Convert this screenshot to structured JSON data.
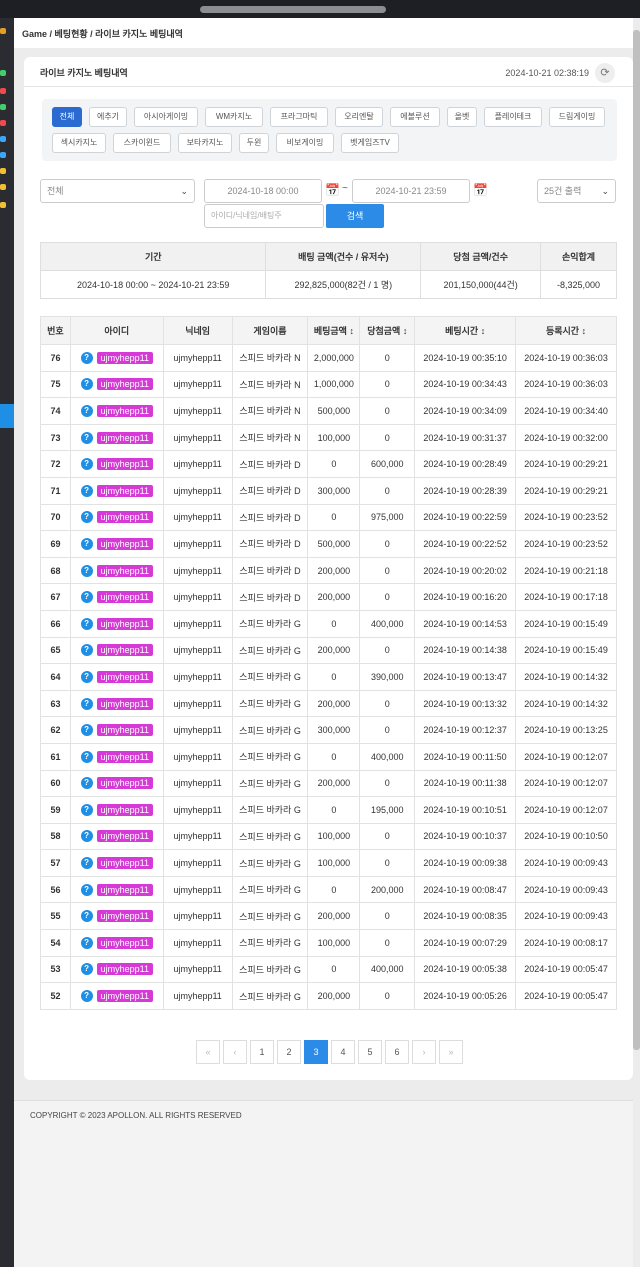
{
  "breadcrumb": "Game / 베팅현황 / 라이브 카지노 베팅내역",
  "card": {
    "title": "라이브 카지노 베팅내역",
    "time": "2024-10-21 02:38:19"
  },
  "categories": [
    "전체",
    "에추기",
    "아시아게이밍",
    "WM카지노",
    "프라그마틱",
    "오리엔탈",
    "에볼루션",
    "올벳",
    "플레이테크",
    "드림게이밍",
    "섹시카지노",
    "스카이윈드",
    "보타카지노",
    "두윈",
    "비보게이밍",
    "벳게임즈TV"
  ],
  "filters": {
    "select_value": "전체",
    "date_from": "2024-10-18 00:00",
    "date_to": "2024-10-21 23:59",
    "per_page": "25건 출력",
    "search_placeholder": "아이디/닉네임/배팅주",
    "search_label": "검색"
  },
  "summary": {
    "headers": [
      "기간",
      "배팅 금액(건수 / 유저수)",
      "당첨 금액/건수",
      "손익합계"
    ],
    "values": [
      "2024-10-18 00:00 ~ 2024-10-21 23:59",
      "292,825,000(82건 / 1 명)",
      "201,150,000(44건)",
      "-8,325,000"
    ]
  },
  "table": {
    "headers": [
      "번호",
      "아이디",
      "닉네임",
      "게임이름",
      "베팅금액 ↕",
      "당첨금액 ↕",
      "베팅시간 ↕",
      "등록시간 ↕"
    ],
    "rows": [
      [
        "76",
        "ujmyhepp11",
        "ujmyhepp11",
        "스피드 바카라 N",
        "2,000,000",
        "0",
        "2024-10-19 00:35:10",
        "2024-10-19 00:36:03"
      ],
      [
        "75",
        "ujmyhepp11",
        "ujmyhepp11",
        "스피드 바카라 N",
        "1,000,000",
        "0",
        "2024-10-19 00:34:43",
        "2024-10-19 00:36:03"
      ],
      [
        "74",
        "ujmyhepp11",
        "ujmyhepp11",
        "스피드 바카라 N",
        "500,000",
        "0",
        "2024-10-19 00:34:09",
        "2024-10-19 00:34:40"
      ],
      [
        "73",
        "ujmyhepp11",
        "ujmyhepp11",
        "스피드 바카라 N",
        "100,000",
        "0",
        "2024-10-19 00:31:37",
        "2024-10-19 00:32:00"
      ],
      [
        "72",
        "ujmyhepp11",
        "ujmyhepp11",
        "스피드 바카라 D",
        "0",
        "600,000",
        "2024-10-19 00:28:49",
        "2024-10-19 00:29:21"
      ],
      [
        "71",
        "ujmyhepp11",
        "ujmyhepp11",
        "스피드 바카라 D",
        "300,000",
        "0",
        "2024-10-19 00:28:39",
        "2024-10-19 00:29:21"
      ],
      [
        "70",
        "ujmyhepp11",
        "ujmyhepp11",
        "스피드 바카라 D",
        "0",
        "975,000",
        "2024-10-19 00:22:59",
        "2024-10-19 00:23:52"
      ],
      [
        "69",
        "ujmyhepp11",
        "ujmyhepp11",
        "스피드 바카라 D",
        "500,000",
        "0",
        "2024-10-19 00:22:52",
        "2024-10-19 00:23:52"
      ],
      [
        "68",
        "ujmyhepp11",
        "ujmyhepp11",
        "스피드 바카라 D",
        "200,000",
        "0",
        "2024-10-19 00:20:02",
        "2024-10-19 00:21:18"
      ],
      [
        "67",
        "ujmyhepp11",
        "ujmyhepp11",
        "스피드 바카라 D",
        "200,000",
        "0",
        "2024-10-19 00:16:20",
        "2024-10-19 00:17:18"
      ],
      [
        "66",
        "ujmyhepp11",
        "ujmyhepp11",
        "스피드 바카라 G",
        "0",
        "400,000",
        "2024-10-19 00:14:53",
        "2024-10-19 00:15:49"
      ],
      [
        "65",
        "ujmyhepp11",
        "ujmyhepp11",
        "스피드 바카라 G",
        "200,000",
        "0",
        "2024-10-19 00:14:38",
        "2024-10-19 00:15:49"
      ],
      [
        "64",
        "ujmyhepp11",
        "ujmyhepp11",
        "스피드 바카라 G",
        "0",
        "390,000",
        "2024-10-19 00:13:47",
        "2024-10-19 00:14:32"
      ],
      [
        "63",
        "ujmyhepp11",
        "ujmyhepp11",
        "스피드 바카라 G",
        "200,000",
        "0",
        "2024-10-19 00:13:32",
        "2024-10-19 00:14:32"
      ],
      [
        "62",
        "ujmyhepp11",
        "ujmyhepp11",
        "스피드 바카라 G",
        "300,000",
        "0",
        "2024-10-19 00:12:37",
        "2024-10-19 00:13:25"
      ],
      [
        "61",
        "ujmyhepp11",
        "ujmyhepp11",
        "스피드 바카라 G",
        "0",
        "400,000",
        "2024-10-19 00:11:50",
        "2024-10-19 00:12:07"
      ],
      [
        "60",
        "ujmyhepp11",
        "ujmyhepp11",
        "스피드 바카라 G",
        "200,000",
        "0",
        "2024-10-19 00:11:38",
        "2024-10-19 00:12:07"
      ],
      [
        "59",
        "ujmyhepp11",
        "ujmyhepp11",
        "스피드 바카라 G",
        "0",
        "195,000",
        "2024-10-19 00:10:51",
        "2024-10-19 00:12:07"
      ],
      [
        "58",
        "ujmyhepp11",
        "ujmyhepp11",
        "스피드 바카라 G",
        "100,000",
        "0",
        "2024-10-19 00:10:37",
        "2024-10-19 00:10:50"
      ],
      [
        "57",
        "ujmyhepp11",
        "ujmyhepp11",
        "스피드 바카라 G",
        "100,000",
        "0",
        "2024-10-19 00:09:38",
        "2024-10-19 00:09:43"
      ],
      [
        "56",
        "ujmyhepp11",
        "ujmyhepp11",
        "스피드 바카라 G",
        "0",
        "200,000",
        "2024-10-19 00:08:47",
        "2024-10-19 00:09:43"
      ],
      [
        "55",
        "ujmyhepp11",
        "ujmyhepp11",
        "스피드 바카라 G",
        "200,000",
        "0",
        "2024-10-19 00:08:35",
        "2024-10-19 00:09:43"
      ],
      [
        "54",
        "ujmyhepp11",
        "ujmyhepp11",
        "스피드 바카라 G",
        "100,000",
        "0",
        "2024-10-19 00:07:29",
        "2024-10-19 00:08:17"
      ],
      [
        "53",
        "ujmyhepp11",
        "ujmyhepp11",
        "스피드 바카라 G",
        "0",
        "400,000",
        "2024-10-19 00:05:38",
        "2024-10-19 00:05:47"
      ],
      [
        "52",
        "ujmyhepp11",
        "ujmyhepp11",
        "스피드 바카라 G",
        "200,000",
        "0",
        "2024-10-19 00:05:26",
        "2024-10-19 00:05:47"
      ]
    ]
  },
  "pagination": {
    "first": "«",
    "prev": "‹",
    "pages": [
      "1",
      "2",
      "3",
      "4",
      "5",
      "6"
    ],
    "active": "3",
    "next": "›",
    "last": "»"
  },
  "footer": "COPYRIGHT © 2023 APOLLON. ALL RIGHTS RESERVED",
  "colors": {
    "accent": "#2b8be6",
    "id_tag": "#d63ad6"
  }
}
